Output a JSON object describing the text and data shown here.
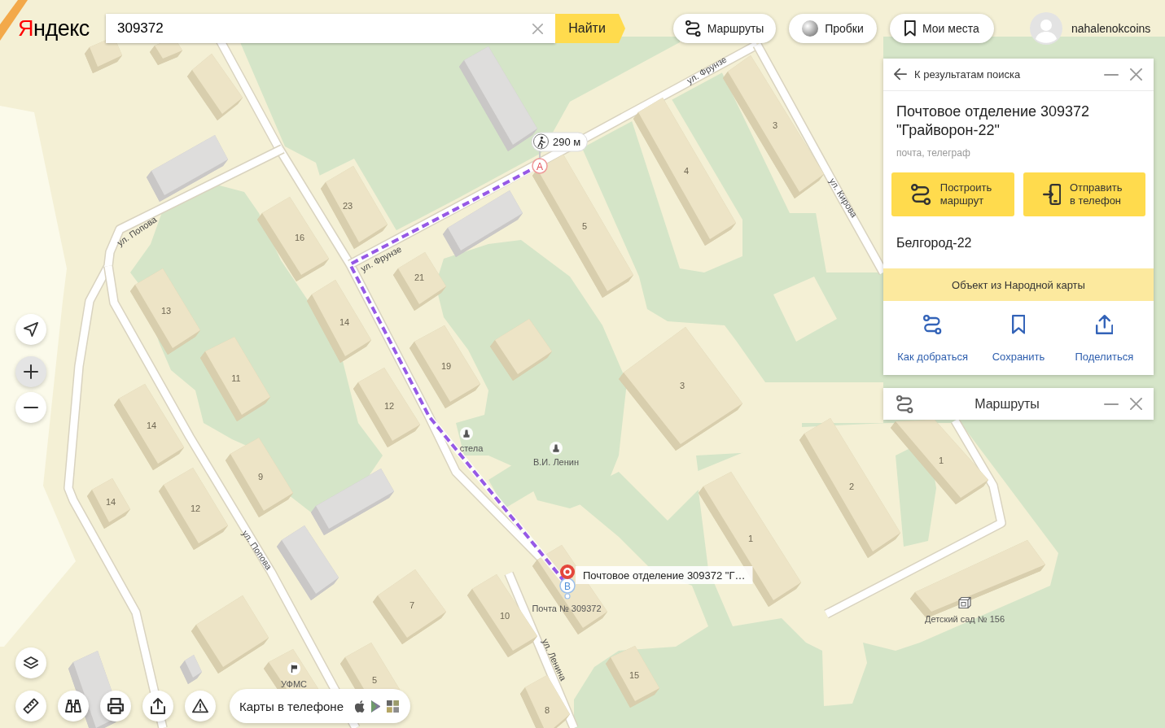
{
  "header": {
    "logo": "Яндекс",
    "search": {
      "value": "309372"
    },
    "search_button": "Найти",
    "buttons": [
      {
        "kind": "routes",
        "label": "Маршруты"
      },
      {
        "kind": "traffic",
        "label": "Пробки"
      },
      {
        "kind": "places",
        "label": "Мои места"
      }
    ],
    "user": {
      "name": "nahalenokcoins"
    }
  },
  "map": {
    "house_numbers": [
      "23",
      "16",
      "21",
      "14",
      "13",
      "11",
      "19",
      "12",
      "14",
      "9",
      "14",
      "12",
      "5",
      "4",
      "3",
      "3",
      "1",
      "2",
      "1",
      "7",
      "10",
      "15",
      "8",
      "5"
    ],
    "streets": [
      "ул. Фрунзе",
      "ул. Фрунзе",
      "ул. Кирова",
      "ул. Попова",
      "ул. Попова",
      "ул. Ленина"
    ],
    "places": [
      {
        "kind": "monument",
        "label": "стела"
      },
      {
        "kind": "monument",
        "label": "В.И. Ленин"
      },
      {
        "kind": "flag",
        "label": "УФМС"
      },
      {
        "kind": "kindergarten",
        "label": "Детский сад № 156"
      },
      {
        "kind": "plain",
        "label": "Почта № 309372"
      }
    ],
    "route": {
      "distance": "290 м",
      "start": "A",
      "end": "B"
    },
    "selected_place": {
      "label": "Почтовое отделение 309372 \"Г…"
    }
  },
  "map_controls": [
    {
      "kind": "locate",
      "disabled": false
    },
    {
      "kind": "zoom_in",
      "disabled": true
    },
    {
      "kind": "zoom_out",
      "disabled": false
    },
    {
      "kind": "layers",
      "disabled": false
    }
  ],
  "map_tools": [
    {
      "kind": "ruler"
    },
    {
      "kind": "panorama"
    },
    {
      "kind": "print"
    },
    {
      "kind": "share"
    },
    {
      "kind": "report"
    }
  ],
  "apps_promo": {
    "label": "Карты в телефоне",
    "stores": [
      {
        "kind": "apple"
      },
      {
        "kind": "google_play"
      },
      {
        "kind": "windows"
      }
    ]
  },
  "place_card": {
    "back": "К результатам поиска",
    "title": "Почтовое отделение 309372 \"Грайворон-22\"",
    "category": "почта, телеграф",
    "actions": [
      {
        "kind": "route",
        "label": "Построить маршрут"
      },
      {
        "kind": "phone",
        "label": "Отправить в телефон"
      }
    ],
    "address": "Белгород-22",
    "notice": "Объект из Народной карты",
    "links": [
      {
        "kind": "directions",
        "label": "Как добраться"
      },
      {
        "kind": "save",
        "label": "Сохранить"
      },
      {
        "kind": "share",
        "label": "Поделиться"
      }
    ]
  },
  "routes_panel": {
    "title": "Маршруты"
  }
}
